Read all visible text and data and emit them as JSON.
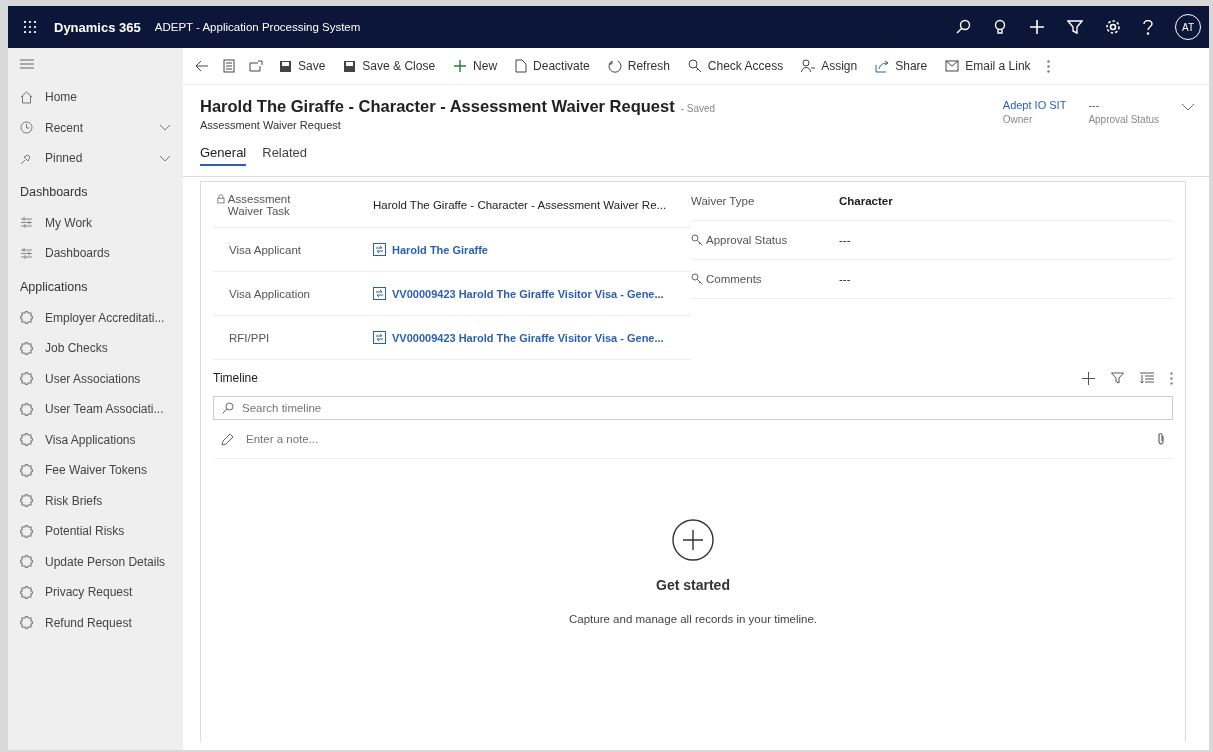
{
  "app_bar": {
    "app_name": "Dynamics 365",
    "title": "ADEPT - Application Processing System",
    "avatar": "AT"
  },
  "command_bar": [
    "Save",
    "Save & Close",
    "New",
    "Deactivate",
    "Refresh",
    "Check Access",
    "Assign",
    "Share",
    "Email a Link"
  ],
  "sidebar": {
    "nav": [
      {
        "label": "Home",
        "expandable": false
      },
      {
        "label": "Recent",
        "expandable": true
      },
      {
        "label": "Pinned",
        "expandable": true
      }
    ],
    "sections": [
      {
        "title": "Dashboards",
        "kind": "dashboard",
        "items": [
          "My Work",
          "Dashboards"
        ]
      },
      {
        "title": "Applications",
        "kind": "entity",
        "items": [
          "Employer Accreditati...",
          "Job Checks",
          "User Associations",
          "User Team Associati...",
          "Visa Applications",
          "Fee Waiver Tokens",
          "Risk Briefs",
          "Potential Risks",
          "Update Person Details",
          "Privacy Request",
          "Refund Request"
        ]
      }
    ]
  },
  "record": {
    "title": "Harold The Giraffe - Character - Assessment Waiver Request",
    "status": "- Saved",
    "subtitle": "Assessment Waiver Request",
    "header_fields": [
      {
        "value": "Adept IO SIT",
        "label": "Owner",
        "kind": "link"
      },
      {
        "value": "---",
        "label": "Approval Status",
        "kind": "text"
      }
    ]
  },
  "tabs": [
    {
      "label": "General",
      "selected": true
    },
    {
      "label": "Related",
      "selected": false
    }
  ],
  "left_fields": [
    {
      "label": "Assessment Waiver Task",
      "value": "Harold The Giraffe - Character - Assessment Waiver Re...",
      "kind": "text",
      "locked": true
    },
    {
      "label": "Visa Applicant",
      "value": "Harold The Giraffe",
      "kind": "lookup",
      "locked": false
    },
    {
      "label": "Visa Application",
      "value": "VV00009423 Harold The Giraffe Visitor Visa - Gene...",
      "kind": "lookup",
      "locked": false
    },
    {
      "label": "RFI/PPI",
      "value": "VV00009423 Harold The Giraffe Visitor Visa - Gene...",
      "kind": "lookup",
      "locked": false
    }
  ],
  "right_fields": [
    {
      "label": "Waiver Type",
      "value": "Character",
      "kind": "text"
    },
    {
      "label": "Approval Status",
      "value": "---",
      "kind": "secured"
    },
    {
      "label": "Comments",
      "value": "---",
      "kind": "secured"
    }
  ],
  "timeline": {
    "title": "Timeline",
    "search_placeholder": "Search timeline",
    "note_placeholder": "Enter a note...",
    "empty_title": "Get started",
    "empty_text": "Capture and manage all records in your timeline."
  }
}
